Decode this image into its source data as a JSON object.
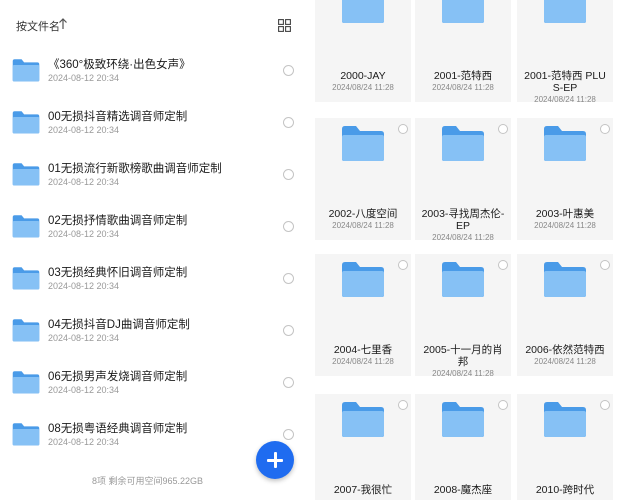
{
  "left_pane": {
    "sort_label": "按文件名",
    "sort_icon": "arrow-up-icon",
    "view_icon": "grid-view-icon",
    "items": [
      {
        "name": "《360°极致环绕·出色女声》",
        "date": "2024-08-12 20:34"
      },
      {
        "name": "00无损抖音精选调音师定制",
        "date": "2024-08-12 20:34"
      },
      {
        "name": "01无损流行新歌榜歌曲调音师定制",
        "date": "2024-08-12 20:34"
      },
      {
        "name": "02无损抒情歌曲调音师定制",
        "date": "2024-08-12 20:34"
      },
      {
        "name": "03无损经典怀旧调音师定制",
        "date": "2024-08-12 20:34"
      },
      {
        "name": "04无损抖音DJ曲调音师定制",
        "date": "2024-08-12 20:34"
      },
      {
        "name": "06无损男声发烧调音师定制",
        "date": "2024-08-12 20:34"
      },
      {
        "name": "08无损粤语经典调音师定制",
        "date": "2024-08-12 20:34"
      }
    ],
    "footer": "8项  剩余可用空间965.22GB",
    "fab_icon": "plus-icon"
  },
  "right_pane": {
    "tiles": [
      {
        "name_lines": [
          "2000-JAY"
        ],
        "date": "2024/08/24 11:28"
      },
      {
        "name_lines": [
          "2001-范特西"
        ],
        "date": "2024/08/24 11:28"
      },
      {
        "name_lines": [
          "2001-范特西 PLU",
          "S-EP"
        ],
        "date": "2024/08/24 11:28"
      },
      {
        "name_lines": [
          "2002-八度空间"
        ],
        "date": "2024/08/24 11:28"
      },
      {
        "name_lines": [
          "2003-寻找周杰伦-",
          "EP"
        ],
        "date": "2024/08/24 11:28"
      },
      {
        "name_lines": [
          "2003-叶惠美"
        ],
        "date": "2024/08/24 11:28"
      },
      {
        "name_lines": [
          "2004-七里香"
        ],
        "date": "2024/08/24 11:28"
      },
      {
        "name_lines": [
          "2005-十一月的肖",
          "邦"
        ],
        "date": "2024/08/24 11:28"
      },
      {
        "name_lines": [
          "2006-依然范特西"
        ],
        "date": "2024/08/24 11:28"
      },
      {
        "name_lines": [
          "2007-我很忙"
        ],
        "date": ""
      },
      {
        "name_lines": [
          "2008-魔杰座"
        ],
        "date": ""
      },
      {
        "name_lines": [
          "2010-跨时代"
        ],
        "date": ""
      }
    ]
  },
  "colors": {
    "folder_back": "#4a9be8",
    "folder_front": "#86c1f5",
    "fab": "#1f6cf0"
  }
}
